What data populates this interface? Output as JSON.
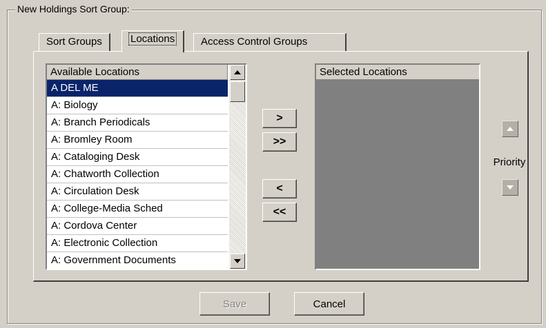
{
  "group": {
    "title": "New Holdings Sort Group:"
  },
  "tabs": [
    {
      "label": "Sort Groups"
    },
    {
      "label": "Locations"
    },
    {
      "label": "Access Control Groups"
    }
  ],
  "available": {
    "header": "Available Locations",
    "items": [
      "A DEL ME",
      "A: Biology",
      "A: Branch Periodicals",
      "A: Bromley Room",
      "A: Cataloging Desk",
      "A: Chatworth Collection",
      "A: Circulation Desk",
      "A: College-Media Sched",
      "A: Cordova Center",
      "A: Electronic Collection",
      "A: Government Documents"
    ],
    "selected_index": 0
  },
  "selected": {
    "header": "Selected Locations"
  },
  "buttons": {
    "add": ">",
    "add_all": ">>",
    "remove": "<",
    "remove_all": "<<",
    "save": "Save",
    "cancel": "Cancel"
  },
  "priority": {
    "label": "Priority"
  }
}
